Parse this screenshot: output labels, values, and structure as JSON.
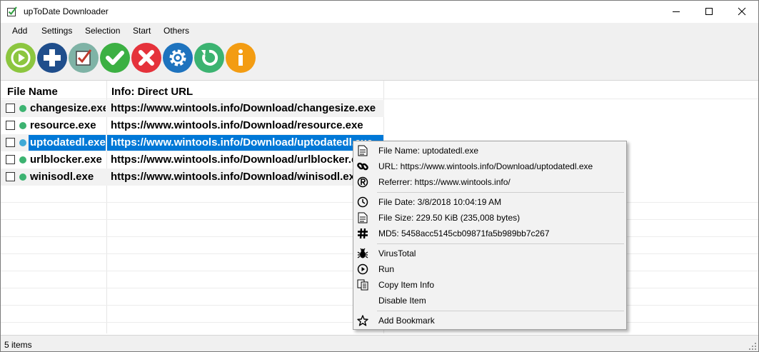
{
  "window": {
    "title": "upToDate Downloader"
  },
  "menu": [
    "Add",
    "Settings",
    "Selection",
    "Start",
    "Others"
  ],
  "toolbar": [
    {
      "icon": "play-circle-icon",
      "color": "#8cc63f"
    },
    {
      "icon": "plus-circle-icon",
      "color": "#1f4e8c"
    },
    {
      "icon": "check-square-icon",
      "color": "#7fb3a6"
    },
    {
      "icon": "check-icon",
      "color": "#3cb043"
    },
    {
      "icon": "cross-icon",
      "color": "#e5323b"
    },
    {
      "icon": "gear-icon",
      "color": "#1e73be"
    },
    {
      "icon": "refresh-icon",
      "color": "#3cb371"
    },
    {
      "icon": "info-icon",
      "color": "#f39c12"
    }
  ],
  "list": {
    "columns": [
      "File Name",
      "Info: Direct URL"
    ],
    "rows": [
      {
        "name": "changesize.exe",
        "url": "https://www.wintools.info/Download/changesize.exe",
        "selected": false,
        "status_color": "#3cb371"
      },
      {
        "name": "resource.exe",
        "url": "https://www.wintools.info/Download/resource.exe",
        "selected": false,
        "status_color": "#3cb371"
      },
      {
        "name": "uptodatedl.exe",
        "url": "https://www.wintools.info/Download/uptodatedl.exe",
        "selected": true,
        "status_color": "#3fa9d6"
      },
      {
        "name": "urlblocker.exe",
        "url": "https://www.wintools.info/Download/urlblocker.exe",
        "selected": false,
        "status_color": "#3cb371"
      },
      {
        "name": "winisodl.exe",
        "url": "https://www.wintools.info/Download/winisodl.exe",
        "selected": false,
        "status_color": "#3cb371"
      }
    ]
  },
  "status": {
    "text": "5 items"
  },
  "context_menu": {
    "groups": [
      [
        {
          "icon": "document-icon",
          "label": "File Name: uptodatedl.exe"
        },
        {
          "icon": "link-icon",
          "label": "URL: https://www.wintools.info/Download/uptodatedl.exe"
        },
        {
          "icon": "registered-icon",
          "label": "Referrer: https://www.wintools.info/"
        }
      ],
      [
        {
          "icon": "clock-icon",
          "label": "File Date: 3/8/2018 10:04:19 AM"
        },
        {
          "icon": "document-icon",
          "label": "File Size: 229.50 KiB (235,008 bytes)"
        },
        {
          "icon": "hash-icon",
          "label": "MD5: 5458acc5145cb09871fa5b989bb7c267"
        }
      ],
      [
        {
          "icon": "bug-icon",
          "label": "VirusTotal"
        },
        {
          "icon": "run-icon",
          "label": "Run"
        },
        {
          "icon": "copy-icon",
          "label": "Copy Item Info"
        },
        {
          "icon": "",
          "label": "Disable Item"
        }
      ],
      [
        {
          "icon": "star-icon",
          "label": "Add Bookmark"
        }
      ]
    ]
  }
}
